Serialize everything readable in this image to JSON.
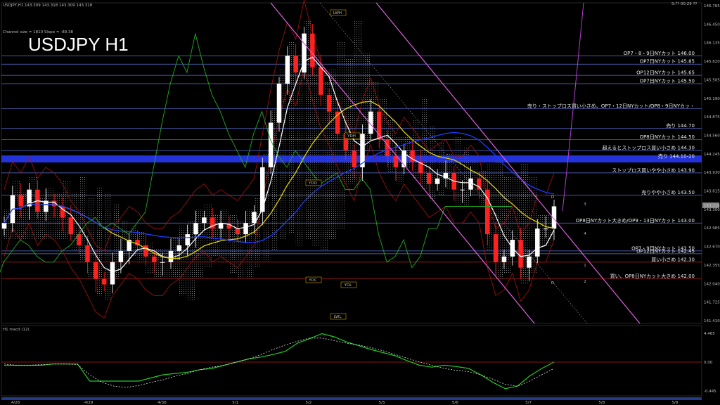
{
  "chart_data": {
    "type": "line",
    "title": "USDJPY H1",
    "header_text": "USDJPY,H1  143.309 143.318 143.309 143.318",
    "top_right_text": "S:?? 00:29 ??",
    "channel_text": "Channel size = 1810  Slope = -89.38",
    "y_axis_ticks": [
      "146.765",
      "146.450",
      "146.135",
      "145.820",
      "145.505",
      "145.190",
      "144.875",
      "144.560",
      "144.245",
      "143.930",
      "143.615",
      "143.300",
      "142.985",
      "142.670",
      "142.355",
      "142.040",
      "141.725",
      "141.410"
    ],
    "current_price": "143.318",
    "x_labels": [
      "4/28",
      "4/29",
      "4/30",
      "5/1",
      "5/2",
      "5/5",
      "5/6",
      "5/7",
      "5/8",
      "5/9"
    ],
    "level_lines": [
      {
        "label": "OP7・8・9日NYカット 146.00",
        "price": 146.0,
        "color": "#5b74d8"
      },
      {
        "label": "OP7日NYカット 145.85",
        "price": 145.85,
        "color": "#5b74d8"
      },
      {
        "label": "OP12日NYカット 145.65",
        "price": 145.65,
        "color": "#5b74d8"
      },
      {
        "label": "OP7日NYカット 145.50",
        "price": 145.5,
        "color": "#5b74d8"
      },
      {
        "label": "売り・ストップロス買い小さめ、OP7・12日NYカット/OP8・9日NYカッ・",
        "price": 145.05,
        "color": "#5b74d8"
      },
      {
        "label": "売り 144.70",
        "price": 144.7,
        "color": "#5b74d8"
      },
      {
        "label": "OP8日NYカット 144.50",
        "price": 144.5,
        "color": "#5b74d8"
      },
      {
        "label": "超えるとストップロス買い小さめ 144.30",
        "price": 144.3,
        "color": "#5b74d8"
      },
      {
        "label": "売り 144.10-20",
        "price": 144.15,
        "color": "#2a3cff"
      },
      {
        "label": "ストップロス買いやや小さめ 143.90",
        "price": 143.9,
        "color": "#5b74d8"
      },
      {
        "label": "売りやや小さめ 143.50",
        "price": 143.5,
        "color": "#5b74d8"
      },
      {
        "label": "OP8日NYカット大きめ/OP9・13日NYカット 143.00",
        "price": 143.0,
        "color": "#5b74d8"
      },
      {
        "label": "OP7・9日NYカット 142.50",
        "price": 142.5,
        "color": "#5b74d8"
      },
      {
        "label": "OP12日NYカット 142.45",
        "price": 142.45,
        "color": "#5b74d8"
      },
      {
        "label": "買い小さめ 142.30",
        "price": 142.3,
        "color": "#cc2222"
      },
      {
        "label": "買い、OP8日NYカット大きめ 142.00",
        "price": 142.0,
        "color": "#cc2222"
      }
    ],
    "marker_labels": [
      "LWH",
      "YDH",
      "YDO",
      "YDC",
      "YDL",
      "LWL",
      "D",
      "D",
      "3",
      "4",
      "1",
      "2"
    ],
    "series": [
      {
        "name": "close",
        "values": [
          143.0,
          143.5,
          143.3,
          143.6,
          143.2,
          143.4,
          143.3,
          143.1,
          142.8,
          142.6,
          142.3,
          142.0,
          141.9,
          142.3,
          142.5,
          142.7,
          142.6,
          142.4,
          142.3,
          142.3,
          142.5,
          142.6,
          142.8,
          143.0,
          143.1,
          142.9,
          143.0,
          142.9,
          142.8,
          143.0,
          143.2,
          144.0,
          144.8,
          145.5,
          146.0,
          145.7,
          146.4,
          145.8,
          145.3,
          145.0,
          144.6,
          144.3,
          144.0,
          144.6,
          145.0,
          144.5,
          144.2,
          144.0,
          144.3,
          144.1,
          143.9,
          143.7,
          143.8,
          143.9,
          143.6,
          143.6,
          143.8,
          143.6,
          142.8,
          142.3,
          142.4,
          142.7,
          142.2,
          142.4,
          142.9,
          142.9,
          143.3
        ]
      }
    ],
    "macd": {
      "label": "H1  macd (12)",
      "ticks": [
        "4.465",
        "0.00",
        "-0.445"
      ],
      "main": [
        -0.05,
        -0.05,
        -0.05,
        -0.05,
        -0.03,
        -0.03,
        -0.03,
        -0.3,
        -0.3,
        -0.3,
        -0.3,
        -0.3,
        -0.25,
        -0.2,
        -0.18,
        -0.16,
        -0.12,
        -0.1,
        -0.05,
        0.0,
        0.05,
        0.08,
        0.12,
        0.17,
        0.3,
        0.37,
        0.45,
        0.4,
        0.32,
        0.26,
        0.2,
        0.15,
        0.1,
        0.02,
        -0.05,
        -0.08,
        -0.05,
        -0.07,
        -0.1,
        -0.2,
        -0.32,
        -0.42,
        -0.38,
        -0.22,
        -0.1,
        0.0
      ],
      "signal": [
        -0.03,
        -0.05,
        -0.05,
        -0.04,
        -0.03,
        -0.03,
        -0.04,
        -0.2,
        -0.32,
        -0.38,
        -0.4,
        -0.37,
        -0.32,
        -0.28,
        -0.22,
        -0.18,
        -0.12,
        -0.08,
        -0.05,
        0.0,
        0.05,
        0.12,
        0.2,
        0.27,
        0.33,
        0.38,
        0.38,
        0.34,
        0.3,
        0.27,
        0.23,
        0.18,
        0.12,
        0.06,
        0.0,
        -0.05,
        -0.1,
        -0.13,
        -0.15,
        -0.2,
        -0.27,
        -0.35,
        -0.38,
        -0.3,
        -0.2,
        -0.1
      ]
    },
    "colors": {
      "up": "#ffffff",
      "down": "#ff2020",
      "ema_white": "#ffffff",
      "ma_yellow": "#e0d000",
      "ma_blue": "#1a3cff",
      "lagging": "#22aa22",
      "channel": "#e060e0",
      "bands": "#aa1010",
      "macd_main": "#22cc22",
      "macd_signal": "#dddddd"
    },
    "ylim": [
      141.2,
      146.95
    ]
  }
}
